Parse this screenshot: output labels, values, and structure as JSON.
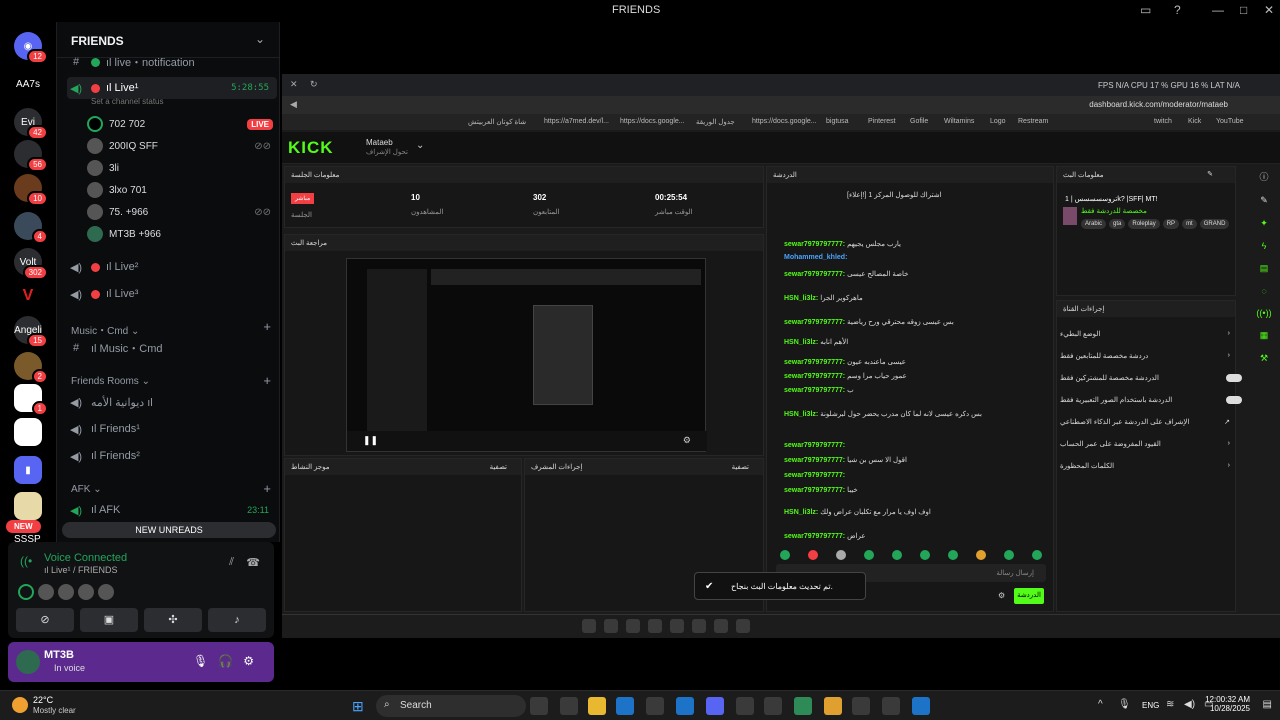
{
  "window": {
    "title": "FRIENDS"
  },
  "server_badges": [
    {
      "label": "",
      "badge": "12"
    },
    {
      "label": "AA7s",
      "badge": ""
    },
    {
      "label": "Evi",
      "badge": "42"
    },
    {
      "label": "",
      "badge": "56"
    },
    {
      "label": "",
      "badge": "10"
    },
    {
      "label": "",
      "badge": "4"
    },
    {
      "label": "Volt",
      "badge": "302"
    },
    {
      "label": "V",
      "badge": ""
    },
    {
      "label": "Angeli",
      "badge": "15"
    },
    {
      "label": "",
      "badge": "2"
    },
    {
      "label": "",
      "badge": "1"
    },
    {
      "label": "",
      "badge": ""
    },
    {
      "label": "",
      "badge": ""
    },
    {
      "label": "SSSP",
      "badge": "NEW"
    }
  ],
  "sidebar": {
    "header": "FRIENDS",
    "ch_live_notification": "ıl live・notification",
    "ch_live1": "ıl Live¹",
    "live1_timer": "5:28:55",
    "live1_status": "Set a channel status",
    "users": [
      {
        "name": "702",
        "tag": "702",
        "right": "LIVE"
      },
      {
        "name": "200IQ",
        "tag": "SFF",
        "right": ""
      },
      {
        "name": "3li",
        "tag": "",
        "right": ""
      },
      {
        "name": "3lxo",
        "tag": "701",
        "right": ""
      },
      {
        "name": "75.",
        "tag": "+966",
        "right": ""
      },
      {
        "name": "MT3B",
        "tag": "+966",
        "right": ""
      }
    ],
    "ch_live2": "ıl Live²",
    "ch_live3": "ıl Live³",
    "cat_music": "Music・Cmd",
    "ch_music": "ıl Music・Cmd",
    "cat_rooms": "Friends Rooms",
    "ch_diwaniya": "ديوانية الأمه ıl",
    "ch_friends1": "ıl Friends¹",
    "ch_friends2": "ıl Friends²",
    "cat_afk": "AFK",
    "ch_afk": "ıl AFK",
    "afk_timer": "23:11",
    "new_unreads": "NEW UNREADS"
  },
  "voice": {
    "title": "Voice Connected",
    "channel": "ıl Live¹ / FRIENDS"
  },
  "user": {
    "name": "MT3B",
    "status": "In voice"
  },
  "browser": {
    "status": "FPS N/A   CPU 17 %   GPU 16 %   LAT N/A",
    "url": "dashboard.kick.com/moderator/mataeb",
    "bookmarks": [
      "شاة كوتان العربيتش",
      "https://a7med.dev/l...",
      "https://docs.google...",
      "جدول الوريقة",
      "https://docs.google...",
      "bigtusa",
      "Pinterest",
      "Gofile",
      "Wiltamins",
      "Logo",
      "Restream",
      "twitch",
      "Kick",
      "YouTube"
    ]
  },
  "kick": {
    "logo": "KICK",
    "streamer": "Mataeb",
    "streamer_sub": "تحول الإشراف",
    "session_title": "معلومات الجلسة",
    "live_badge": "مباشر",
    "session_label": "الجلسة",
    "stats": [
      {
        "value": "10",
        "label": "المشاهدون"
      },
      {
        "value": "302",
        "label": "المتابعون"
      },
      {
        "value": "00:25:54",
        "label": "الوقت مباشر"
      }
    ],
    "preview_title": "مراجعة البث",
    "activity_title": "موجز النشاط",
    "filter_label": "تصفية",
    "mod_actions_title": "إجراءات المشرف",
    "chat_title": "الدردشة",
    "pinned": "[إعلاء!] اشتراك للوصول المركز 1",
    "messages": [
      {
        "user": "sewar7979797777:",
        "text": "يارب مجلس يجيهم"
      },
      {
        "user": "Mohammed_khled:",
        "text": ""
      },
      {
        "user": "sewar7979797777:",
        "text": "خاصة المصالح عيسى"
      },
      {
        "user": "HSN_li3lz:",
        "text": "ماهركوير الجرا"
      },
      {
        "user": "sewar7979797777:",
        "text": "بس عيسى زوقه محترقي ورح رياضية"
      },
      {
        "user": "HSN_li3lz:",
        "text": "الأهم انابه"
      },
      {
        "user": "sewar7979797777:",
        "text": "عيسى ماعندبه عيون"
      },
      {
        "user": "sewar7979797777:",
        "text": "عمور حياب مرا وسم"
      },
      {
        "user": "sewar7979797777:",
        "text": "ب"
      },
      {
        "user": "HSN_li3lz:",
        "text": "بس دكره عيسى لانه لما كان مدرب يحضر حول لبرشلونة"
      },
      {
        "user": "sewar7979797777:",
        "text": ""
      },
      {
        "user": "sewar7979797777:",
        "text": "اقول الا سس بن شيا"
      },
      {
        "user": "sewar7979797777:",
        "text": ""
      },
      {
        "user": "sewar7979797777:",
        "text": "خيبا"
      },
      {
        "user": "HSN_li3lz:",
        "text": "اوف اوف يا مرار مع تكلبان عراض ولك"
      },
      {
        "user": "sewar7979797777:",
        "text": "عراض"
      }
    ],
    "chat_placeholder": "إرسال رسالة",
    "chat_send": "الدردشة",
    "toast": "تم تحديث معلومات البث بنجاح.",
    "stream_info_title": "معلومات البث",
    "stream_title": "تروسسسسس | 1k? |SFF| MT!",
    "stream_sub": "مخصصة للدردشة فقط",
    "tags": [
      "Arabic",
      "gta",
      "Roleplay",
      "RP",
      "mt",
      "GRAND"
    ],
    "channel_actions_title": "إجراءات القناة",
    "channel_actions": [
      "الوضع البطيء",
      "دردشة مخصصة للمتابعين فقط",
      "الدردشة مخصصة للمشتركين فقط",
      "الدردشة باستخدام الصور التعبيرية فقط",
      "الإشراف على الدردشة عبر الذكاء الاصطناعي",
      "القيود المفروضة على عمر الحساب",
      "الكلمات المحظورة"
    ]
  },
  "taskbar": {
    "temp": "22°C",
    "weather": "Mostly clear",
    "search": "Search",
    "lang": "ENG",
    "time": "12:00:32 AM",
    "date": "10/28/2025"
  }
}
